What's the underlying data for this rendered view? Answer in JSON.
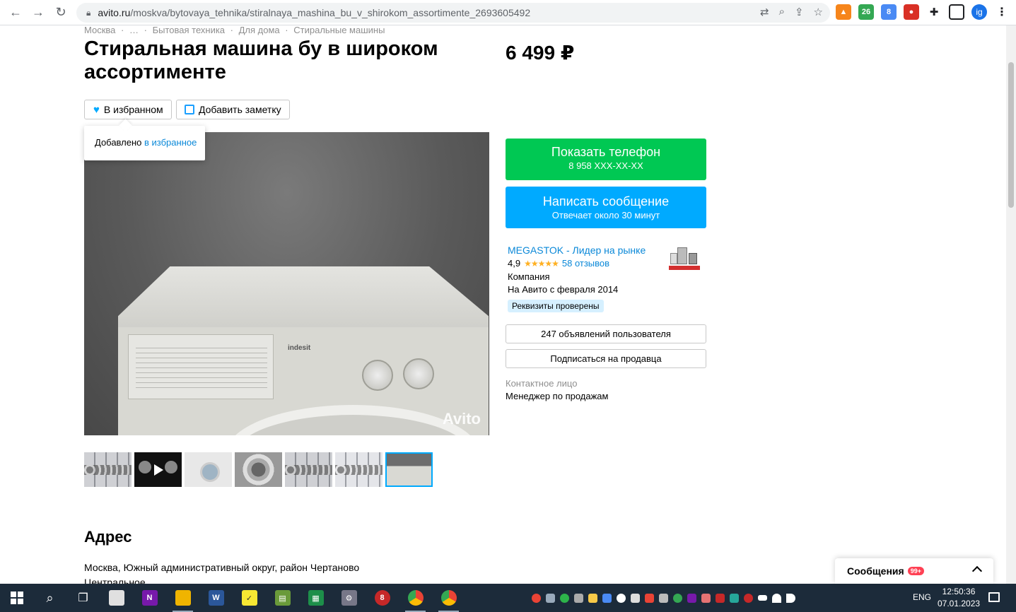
{
  "browser": {
    "url_host": "avito.ru",
    "url_path": "/moskva/bytovaya_tehnika/stiralnaya_mashina_bu_v_shirokom_assortimente_2693605492",
    "ext_badge_1": "26",
    "ext_badge_2": "8",
    "profile_initials": "ig"
  },
  "breadcrumb": [
    "Москва",
    "·",
    "…",
    "·",
    "Бытовая техника",
    "·",
    "Для дома",
    "·",
    "Стиральные машины"
  ],
  "listing": {
    "title": "Стиральная машина бу в широком ассортименте",
    "price": "6 499 ₽",
    "favorite_label": "В избранном",
    "note_label": "Добавить заметку",
    "popup_text": "Добавлено",
    "popup_link": "в избранное",
    "photo_brand": "indesit",
    "watermark": "Avito"
  },
  "actions": {
    "phone_label": "Показать телефон",
    "phone_number": "8 958 XXX-XX-XX",
    "message_label": "Написать сообщение",
    "message_sub": "Отвечает около 30 минут"
  },
  "seller": {
    "name": "MEGASTOK - Лидер на рынке",
    "rating": "4,9",
    "stars": "★★★★★",
    "reviews": "58 отзывов",
    "type": "Компания",
    "since": "На Авито с февраля 2014",
    "verified": "Реквизиты проверены",
    "listings_button": "247 объявлений пользователя",
    "subscribe_button": "Подписаться на продавца",
    "contact_label": "Контактное лицо",
    "contact_value": "Менеджер по продажам"
  },
  "address": {
    "heading": "Адрес",
    "text": "Москва, Южный административный округ, район Чертаново Центральное"
  },
  "messages": {
    "label": "Сообщения",
    "badge": "99+"
  },
  "taskbar": {
    "lang": "ENG",
    "time": "12:50:36",
    "date": "07.01.2023"
  },
  "colors": {
    "phone_button": "#00c853",
    "message_button": "#00aaff",
    "link": "#0a88d8",
    "taskbar": "#1c2b3a"
  }
}
